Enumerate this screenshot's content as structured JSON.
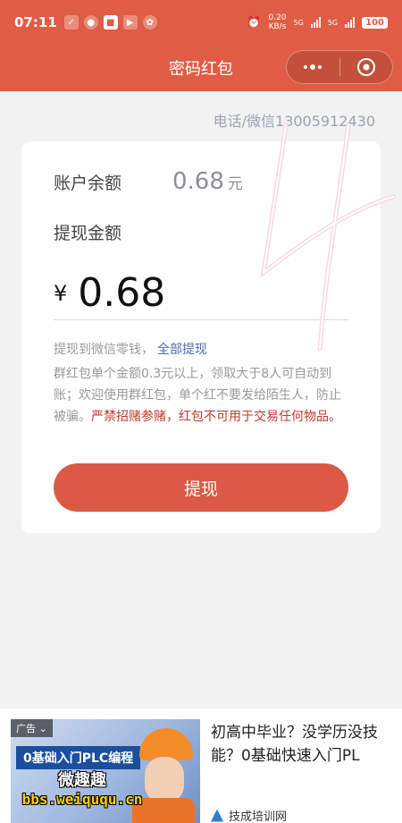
{
  "status_bar": {
    "time": "07:11",
    "net_speed_value": "0.20",
    "net_speed_unit": "KB/s",
    "network_1": "5G",
    "network_2": "5G",
    "battery": "100"
  },
  "nav": {
    "title": "密码红包"
  },
  "contact": {
    "text": "电话/微信13005912430"
  },
  "card": {
    "balance_label": "账户余额",
    "balance_value": "0.68",
    "balance_unit": "元",
    "withdraw_label": "提现金额",
    "currency_symbol": "¥",
    "amount": "0.68",
    "note_prefix": "提现到微信零钱，",
    "note_link": "全部提现",
    "note_body": "群红包单个金额0.3元以上，领取大于8人可自动到账；欢迎使用群红包，单个红不要发给陌生人，防止被骗。",
    "note_warning": "严禁招赌参赌，红包不可用于交易任何物品。",
    "button_label": "提现"
  },
  "ad": {
    "tag": "广告",
    "banner_title": "0基础入门PLC编程",
    "headline": "初高中毕业？没学历没技能？0基础快速入门PL",
    "source": "技成培训网"
  },
  "watermark": {
    "line1": "微趣趣",
    "line2": "bbs.weiququ.cn"
  },
  "colors": {
    "brand": "#e05c44",
    "button": "#dc5a45",
    "warning": "#c0392b",
    "link": "#4a6ea9"
  }
}
